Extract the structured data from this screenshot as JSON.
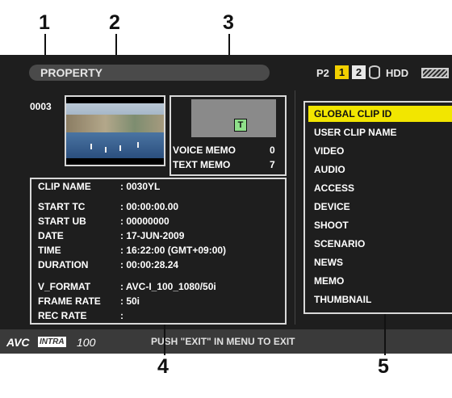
{
  "callouts": {
    "n1": "1",
    "n2": "2",
    "n3": "3",
    "n4": "4",
    "n5": "5"
  },
  "header": {
    "title": "PROPERTY"
  },
  "status": {
    "media_label": "P2",
    "slot1": "1",
    "slot2": "2",
    "hdd_label": "HDD",
    "icons": [
      "hdd-icon",
      "battery-icon"
    ]
  },
  "clip": {
    "number": "0003"
  },
  "memo": {
    "t_icon": "T",
    "voice_label": "VOICE MEMO",
    "voice_count": "0",
    "text_label": "TEXT MEMO",
    "text_count": "7"
  },
  "info": {
    "rows": [
      {
        "key": "CLIP NAME",
        "value": ": 0030YL"
      },
      {
        "key": "START TC",
        "value": ": 00:00:00.00"
      },
      {
        "key": "START UB",
        "value": ": 00000000"
      },
      {
        "key": "DATE",
        "value": ": 17-JUN-2009"
      },
      {
        "key": "TIME",
        "value": ": 16:22:00 (GMT+09:00)"
      },
      {
        "key": "DURATION",
        "value": ": 00:00:28.24"
      },
      {
        "key": "V_FORMAT",
        "value": ": AVC-I_100_1080/50i"
      },
      {
        "key": "FRAME RATE",
        "value": ": 50i"
      },
      {
        "key": "REC RATE",
        "value": ":"
      }
    ]
  },
  "menu": {
    "items": [
      "GLOBAL CLIP ID",
      "USER CLIP NAME",
      "VIDEO",
      "AUDIO",
      "ACCESS",
      "DEVICE",
      "SHOOT",
      "SCENARIO",
      "NEWS",
      "MEMO",
      "THUMBNAIL"
    ],
    "selected": "GLOBAL CLIP ID"
  },
  "footer": {
    "logo_avc": "AVC",
    "logo_intra": "INTRA",
    "logo_100": "100",
    "message": "PUSH \"EXIT\" IN MENU TO EXIT"
  },
  "colors": {
    "screen_bg": "#1e1e1e",
    "highlight": "#f2e600",
    "slot_active": "#f2d000",
    "t_icon": "#8fe08a"
  }
}
